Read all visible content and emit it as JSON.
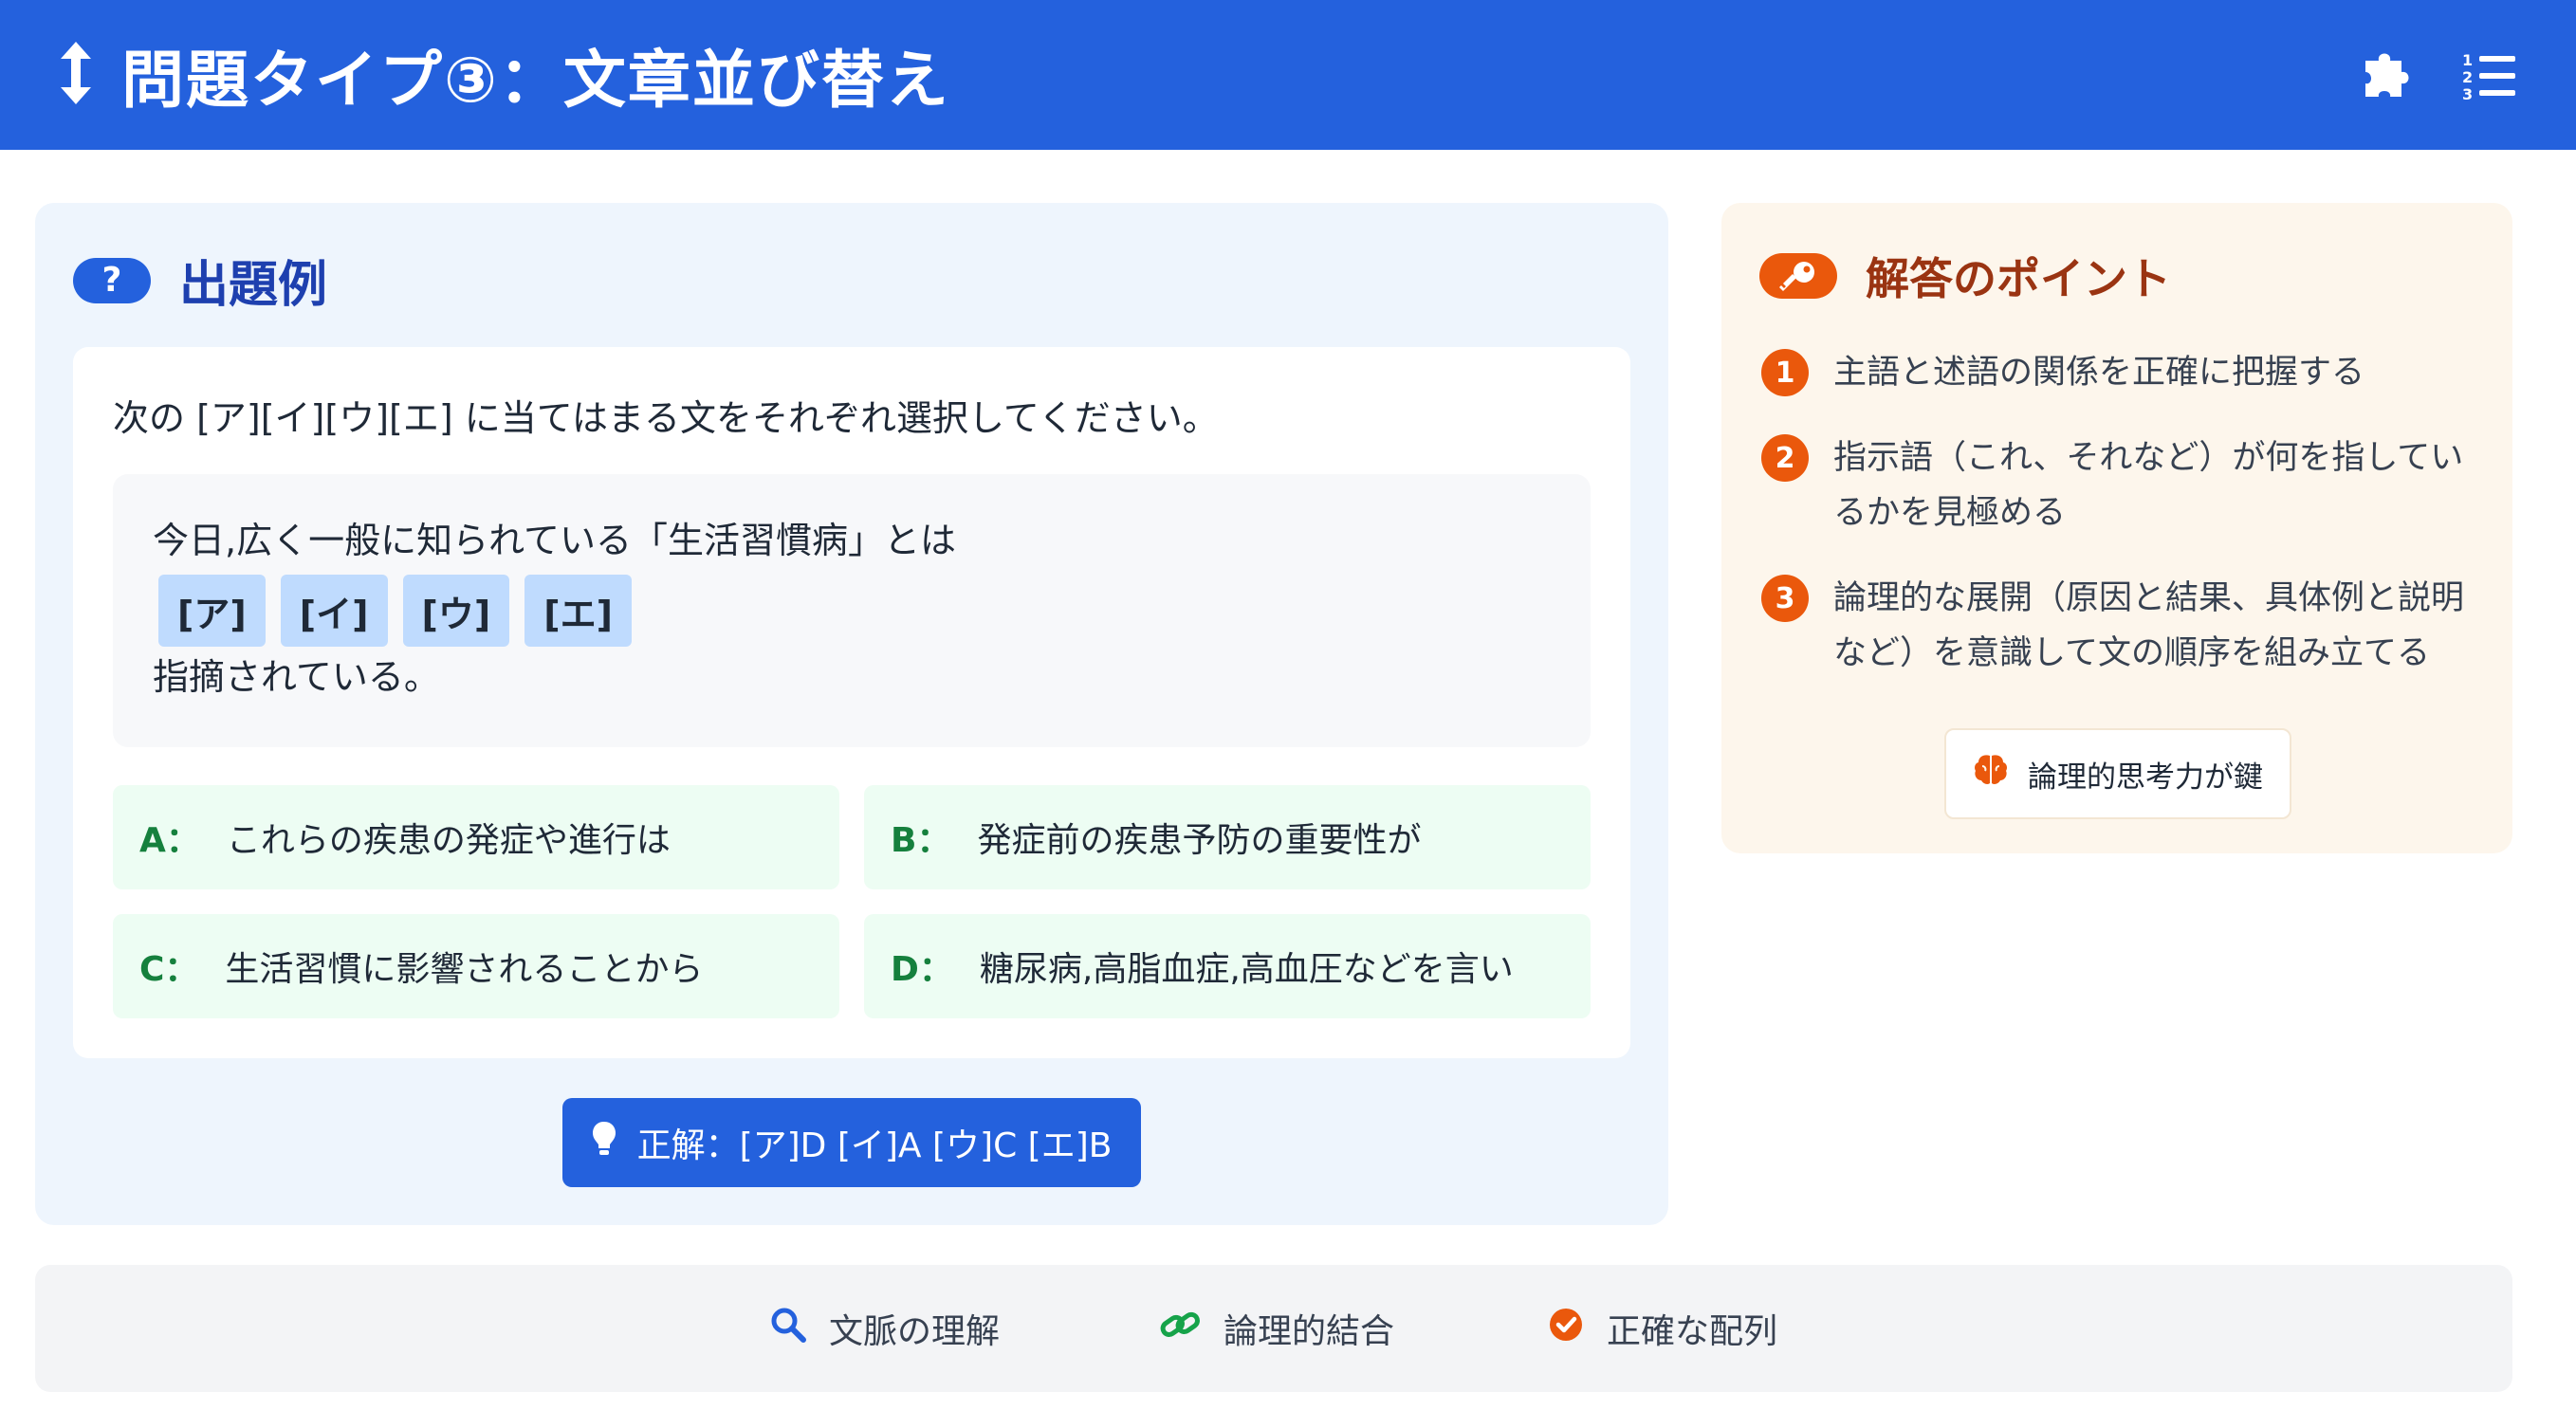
{
  "header": {
    "title": "問題タイプ③：文章並び替え",
    "icons": [
      "updown-arrow-icon",
      "puzzle-icon",
      "numbered-list-icon"
    ]
  },
  "example": {
    "section_title": "出題例",
    "badge": "?",
    "instruction": "次の [ア][イ][ウ][エ] に当てはまる文をそれぞれ選択してください。",
    "passage_before": "今日,広く一般に知られている「生活習慣病」とは",
    "blanks": [
      "[ア]",
      "[イ]",
      "[ウ]",
      "[エ]"
    ],
    "passage_after": "指摘されている。",
    "options": [
      {
        "key": "A：",
        "text": "これらの疾患の発症や進行は"
      },
      {
        "key": "B：",
        "text": "発症前の疾患予防の重要性が"
      },
      {
        "key": "C：",
        "text": "生活習慣に影響されることから"
      },
      {
        "key": "D：",
        "text": "糖尿病,高脂血症,高血圧などを言い"
      }
    ],
    "answer_label": "正解：[ア]D [イ]A [ウ]C [エ]B"
  },
  "tips": {
    "title": "解答のポイント",
    "points": [
      {
        "num": "1",
        "text": "主語と述語の関係を正確に把握する"
      },
      {
        "num": "2",
        "text": "指示語（これ、それなど）が何を指しているかを見極める"
      },
      {
        "num": "3",
        "text": "論理的な展開（原因と結果、具体例と説明など）を意識して文の順序を組み立てる"
      }
    ],
    "tag": "論理的思考力が鍵"
  },
  "footer": {
    "items": [
      {
        "label": "文脈の理解",
        "icon": "search-icon"
      },
      {
        "label": "論理的結合",
        "icon": "link-icon"
      },
      {
        "label": "正確な配列",
        "icon": "check-circle-icon"
      }
    ]
  },
  "colors": {
    "primary": "#2461dd",
    "accent_orange": "#ea580c",
    "option_bg": "#edfdf3",
    "option_key": "#15803d",
    "blank_bg": "#bfdbfe"
  }
}
